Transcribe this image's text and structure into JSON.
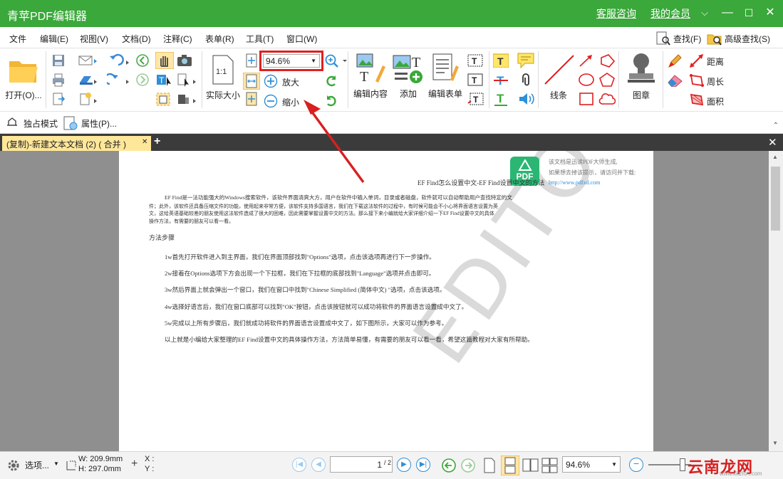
{
  "app": {
    "title": "青苹PDF编辑器",
    "support_link": "客服咨询",
    "membership_link": "我的会员",
    "caret": "⌵",
    "minimize": "—",
    "maximize": "☐",
    "close": "✕"
  },
  "menu": {
    "items": [
      "文件",
      "编辑(E)",
      "视图(V)",
      "文档(D)",
      "注释(C)",
      "表单(R)",
      "工具(T)",
      "窗口(W)"
    ],
    "find": "查找(F)",
    "advanced_find": "高级查找(S)"
  },
  "ribbon": {
    "open": "打开(O)...",
    "actual_size": "实际大小",
    "zoom_value": "94.6%",
    "zoom_in": "放大",
    "zoom_out": "缩小",
    "edit_content": "编辑内容",
    "add": "添加",
    "edit_form": "编辑表单",
    "lines": "线条",
    "stamp": "图章",
    "distance": "距离",
    "perimeter": "周长",
    "area": "面积"
  },
  "subbar": {
    "exclusive_mode": "独占模式",
    "properties": "属性(P)..."
  },
  "tabs": {
    "doc_tab": "(复制)-新建文本文档 (2) ( 合并 )",
    "tab_close": "✕",
    "add": "+",
    "close_all": "✕"
  },
  "document": {
    "badge": "PDF",
    "notice_line1": "该文档是迅读PDF大师生成,",
    "notice_line2": "如果想去掉该提示，请访问并下载:",
    "notice_line3": "http://www.pdfxd.com",
    "header": "EF Find怎么设置中文-EF Find设置中文的方法",
    "intro_1": "EF Find是一法功能强大的Windows搜索软件，该软件界面清爽大方，用户在软件中输入单词，目录或者磁盘，软件就可以自动帮助用户查找特定的文",
    "intro_2": "件；此外，该软件还具备压缩文件的功能，使用起来非常方便，该软件支持多国语言，我们在下载这法软件的过程中，有时候可能会不小心将界面语言设置为英",
    "intro_3": "文，这给英语基础较差的朋友使用这法软件造成了很大的困难，因此需要掌握设置中文的方法。那么接下来小编就给大家详细介绍一下EF Find设置中文的具体",
    "intro_4": "操作方法，有需要的朋友可以看一看。",
    "section": "方法步骤",
    "step1": "1w首先打开软件进入到主界面，我们在界面顶部找到\"Options\"选项，点击该选项再进行下一步操作。",
    "step2": "2w接着在Options选项下方会出现一个下拉框，我们在下拉框的底部找到\"Language\"选项并点击即可。",
    "step3": "3w然后界面上就会弹出一个窗口，我们在窗口中找到\"Chinese Simplified (简体中文) \"选项，点击该选项。",
    "step4": "4w选择好语言后，我们在窗口底部可以找到\"OK\"按钮，点击该按钮就可以成功将软件的界面语言设置成中文了。",
    "step5": "5w完成以上所有步骤后，我们就成功将软件的界面语言设置成中文了，如下图所示，大家可以作为参考。",
    "summary": "以上就是小编给大家整理的EF Find设置中文的具体操作方法，方法简单易懂，有需要的朋友可以看一看，希望这篇教程对大家有所帮助。",
    "watermark": "EDITOR"
  },
  "status": {
    "options": "选项...",
    "width": "W: 209.9mm",
    "height": "H: 297.0mm",
    "x": "X :",
    "y": "Y :",
    "page_value": "1",
    "page_total": "/ 2",
    "zoom": "94.6%"
  },
  "site_watermark": {
    "brand": "云南龙网",
    "url": "www.kkzfon.com"
  },
  "colors": {
    "titlebar": "#3aa83a",
    "tab_active": "#ffe79a",
    "highlight_red": "#e02020",
    "accent_blue": "#2f8fd8"
  }
}
